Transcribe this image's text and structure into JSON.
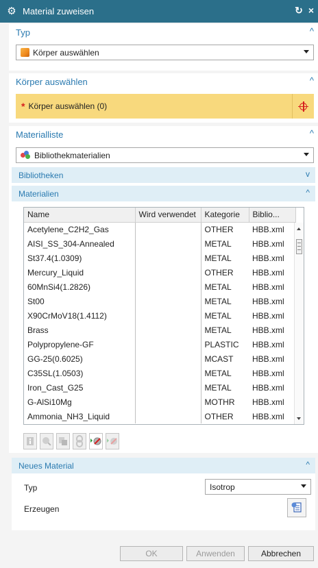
{
  "window": {
    "title": "Material zuweisen",
    "reset_glyph": "↻",
    "close_glyph": "×"
  },
  "typ_section": {
    "title": "Typ",
    "dropdown_value": "Körper auswählen"
  },
  "select_section": {
    "title": "Körper auswählen",
    "required_marker": "*",
    "row_label": "Körper auswählen (0)"
  },
  "materialliste": {
    "title": "Materialliste",
    "dropdown_value": "Bibliothekmaterialien",
    "bibliotheken_label": "Bibliotheken",
    "materialien_label": "Materialien",
    "columns": [
      "Name",
      "Wird verwendet",
      "Kategorie",
      "Biblio..."
    ],
    "rows": [
      {
        "name": "Acetylene_C2H2_Gas",
        "used": "",
        "category": "OTHER",
        "library": "HBB.xml"
      },
      {
        "name": "AISI_SS_304-Annealed",
        "used": "",
        "category": "METAL",
        "library": "HBB.xml"
      },
      {
        "name": "St37.4(1.0309)",
        "used": "",
        "category": "METAL",
        "library": "HBB.xml"
      },
      {
        "name": "Mercury_Liquid",
        "used": "",
        "category": "OTHER",
        "library": "HBB.xml"
      },
      {
        "name": "60MnSi4(1.2826)",
        "used": "",
        "category": "METAL",
        "library": "HBB.xml"
      },
      {
        "name": "St00",
        "used": "",
        "category": "METAL",
        "library": "HBB.xml"
      },
      {
        "name": "X90CrMoV18(1.4112)",
        "used": "",
        "category": "METAL",
        "library": "HBB.xml"
      },
      {
        "name": "Brass",
        "used": "",
        "category": "METAL",
        "library": "HBB.xml"
      },
      {
        "name": "Polypropylene-GF",
        "used": "",
        "category": "PLASTIC",
        "library": "HBB.xml"
      },
      {
        "name": "GG-25(0.6025)",
        "used": "",
        "category": "MCAST",
        "library": "HBB.xml"
      },
      {
        "name": "C35SL(1.0503)",
        "used": "",
        "category": "METAL",
        "library": "HBB.xml"
      },
      {
        "name": "Iron_Cast_G25",
        "used": "",
        "category": "METAL",
        "library": "HBB.xml"
      },
      {
        "name": "G-AlSi10Mg",
        "used": "",
        "category": "MOTHR",
        "library": "HBB.xml"
      },
      {
        "name": "Ammonia_NH3_Liquid",
        "used": "",
        "category": "OTHER",
        "library": "HBB.xml"
      }
    ],
    "toolbar_icons": [
      "info-icon",
      "inspect-icon",
      "copy-icon",
      "link-icon",
      "assign-icon",
      "unassign-icon"
    ]
  },
  "neues_material": {
    "title": "Neues Material",
    "typ_label": "Typ",
    "typ_value": "Isotrop",
    "erzeugen_label": "Erzeugen"
  },
  "footer": {
    "ok_label": "OK",
    "apply_label": "Anwenden",
    "cancel_label": "Abbrechen"
  },
  "colors": {
    "titlebar": "#2b6f8a",
    "section_text": "#2a7ab0",
    "selection_highlight": "#f8d97d",
    "required": "#d62020"
  }
}
